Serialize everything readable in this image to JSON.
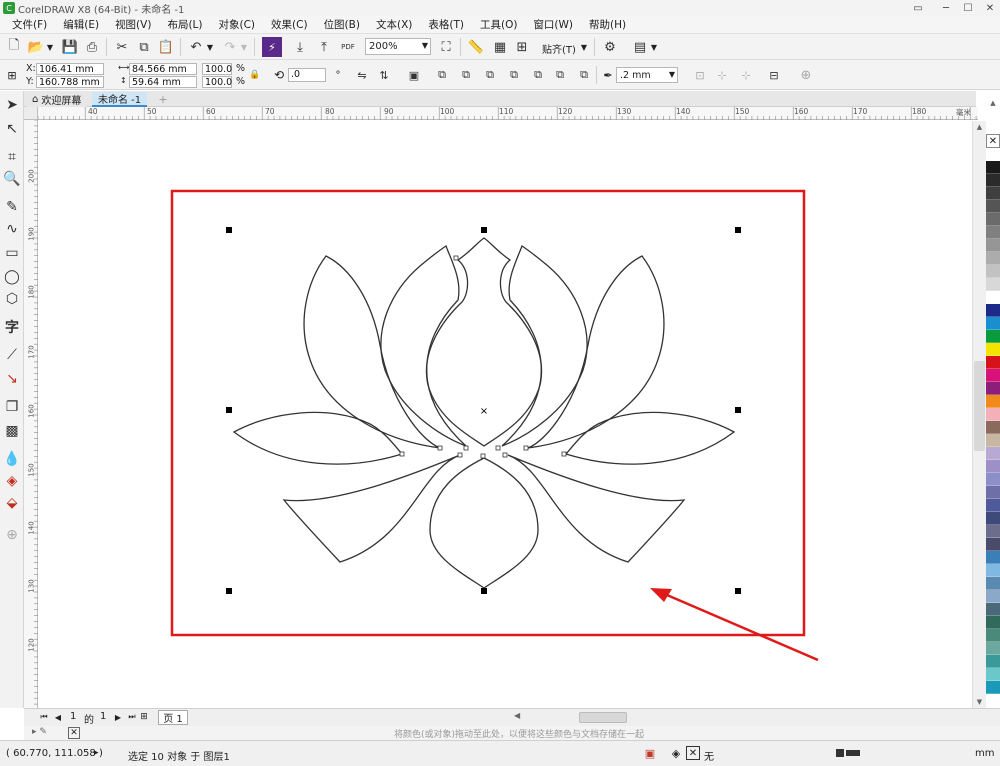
{
  "window": {
    "title": "CorelDRAW X8 (64-Bit) - 未命名 -1"
  },
  "menu": [
    "文件(F)",
    "编辑(E)",
    "视图(V)",
    "布局(L)",
    "对象(C)",
    "效果(C)",
    "位图(B)",
    "文本(X)",
    "表格(T)",
    "工具(O)",
    "窗口(W)",
    "帮助(H)"
  ],
  "standard_toolbar": {
    "zoom": "200%",
    "snap_label": "贴齐(T)",
    "pdf_label": "PDF"
  },
  "property_bar": {
    "x_label": "X:",
    "x_value": "106.41 mm",
    "y_label": "Y:",
    "y_value": "160.788 mm",
    "width_value": "84.566 mm",
    "height_value": "59.64 mm",
    "scale_w": "100.0",
    "scale_h": "100.0",
    "percent": "%",
    "rotation": ".0",
    "outline_width": ".2 mm"
  },
  "doc_tabs": {
    "welcome": "欢迎屏幕",
    "current": "未命名 -1"
  },
  "ruler": {
    "h_ticks": [
      "40",
      "50",
      "60",
      "70",
      "80",
      "90",
      "100",
      "110",
      "120",
      "130",
      "140",
      "150",
      "160",
      "170",
      "180"
    ],
    "h_unit": "毫米",
    "v_ticks": [
      "200",
      "190",
      "180",
      "170",
      "160",
      "150",
      "140",
      "130",
      "120"
    ]
  },
  "page_nav": {
    "current": "1",
    "of_label": "的",
    "total": "1",
    "page_tab": "页 1"
  },
  "color_hint": "将颜色(或对象)拖动至此处，以便将这些颜色与文档存储在一起",
  "status": {
    "coords": "( 60.770, 111.058 )",
    "selection": "选定 10 对象 于 图层1",
    "fill_none": "无",
    "outline_text": "mm"
  },
  "colors": {
    "highlight_box": "#e01919",
    "arrow": "#e01919",
    "palette": [
      "#ffffff",
      "#1a1a1a",
      "#2b2b2b",
      "#3f3f3f",
      "#555555",
      "#6b6b6b",
      "#808080",
      "#969696",
      "#acacac",
      "#c2c2c2",
      "#d8d8d8",
      "#ffffff",
      "#1d2a8a",
      "#1a8fd0",
      "#0a9b3e",
      "#f4e500",
      "#d8121b",
      "#d8127a",
      "#8d1f7a",
      "#f08a1b",
      "#f3b0b8",
      "#8a6a5a",
      "#c8b7a0",
      "#b7a8d4",
      "#9d8fc8",
      "#8d8fc8",
      "#6f6fa8",
      "#4f5a9a",
      "#3e4a7a",
      "#6c6d8a",
      "#4a4a6a",
      "#3b7fb8",
      "#7fb8e0",
      "#5a8ab0",
      "#8aa8c8",
      "#4a6a7a",
      "#2f6a5a",
      "#4a8a7a",
      "#6aa8a0",
      "#3a9a9a",
      "#6ac8c8",
      "#1a9ab8"
    ]
  }
}
